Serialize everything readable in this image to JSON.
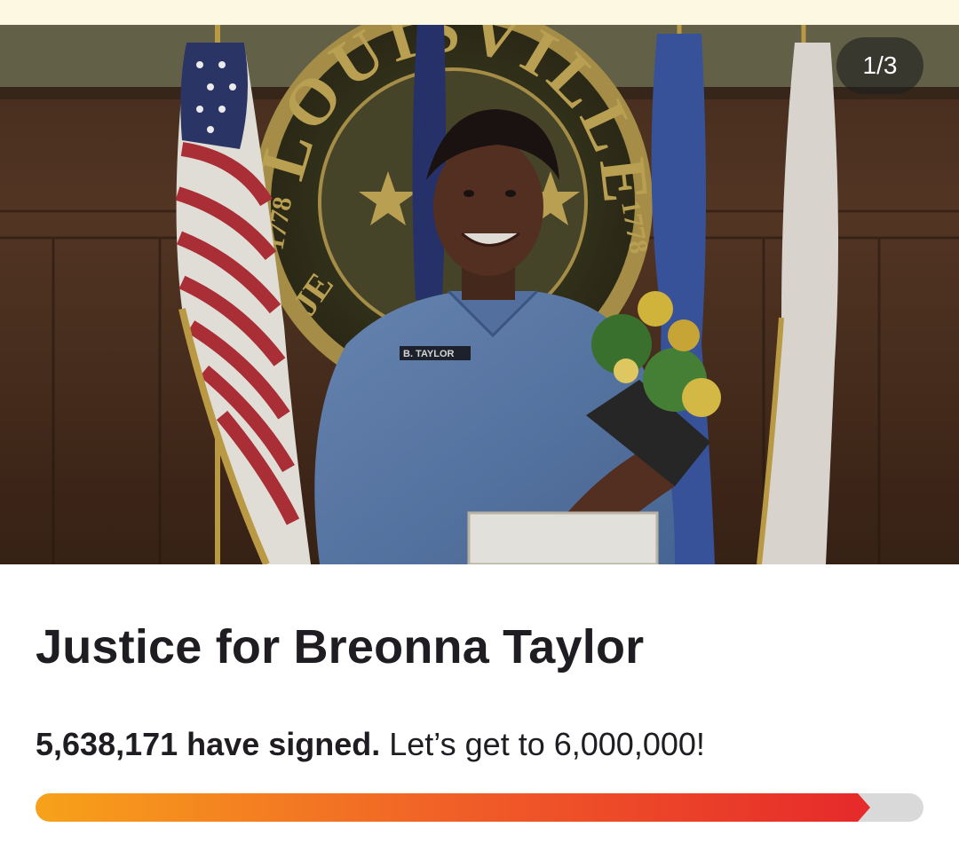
{
  "photo": {
    "counter": "1/3",
    "seal": {
      "arc_text": "LOUISVILLE",
      "year_left": "1778",
      "year_right": "1778",
      "bottom_fragment": "JE"
    },
    "name_tag": "B. TAYLOR"
  },
  "petition": {
    "title": "Justice for Breonna Taylor",
    "signed_count": "5,638,171",
    "signed_suffix": "have signed.",
    "goal_text": "Let’s get to 6,000,000!",
    "progress_fraction": 0.9397
  },
  "colors": {
    "progress_start": "#f7a21a",
    "progress_end": "#e62b2a",
    "progress_track": "#d9d9d9",
    "title_text": "#1f1c22"
  }
}
